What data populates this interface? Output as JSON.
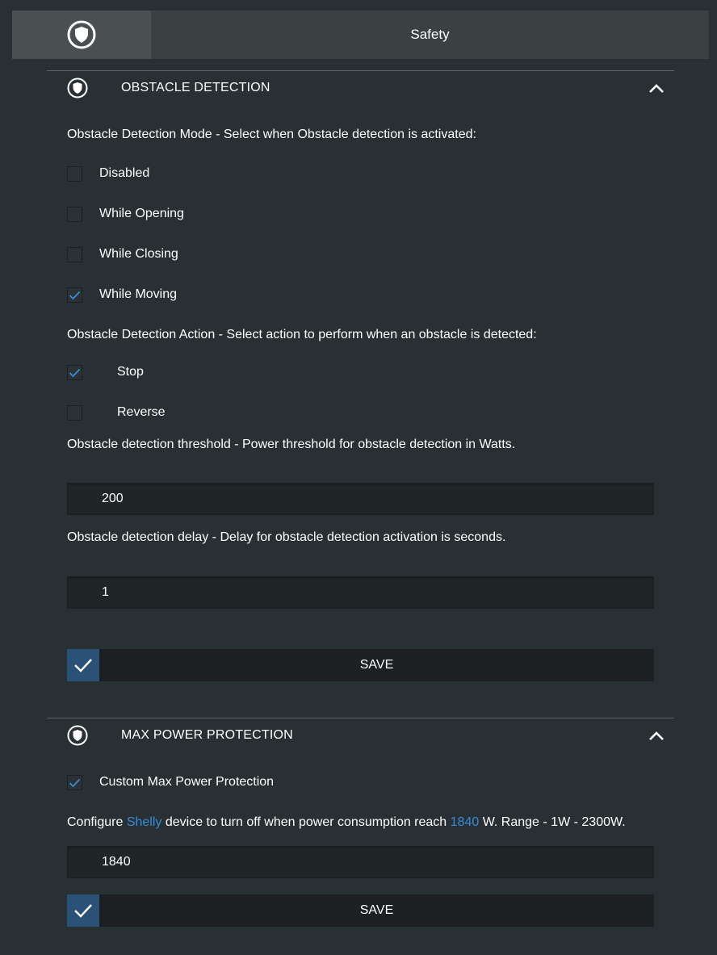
{
  "header": {
    "title": "Safety",
    "icon": "shield-icon"
  },
  "obstacle_section": {
    "title": "OBSTACLE DETECTION",
    "mode_prompt": "Obstacle Detection Mode - Select when Obstacle detection is activated:",
    "mode_options": [
      {
        "label": "Disabled",
        "checked": false
      },
      {
        "label": "While Opening",
        "checked": false
      },
      {
        "label": "While Closing",
        "checked": false
      },
      {
        "label": "While Moving",
        "checked": true
      }
    ],
    "action_prompt": "Obstacle Detection Action - Select action to perform when an obstacle is detected:",
    "action_options": [
      {
        "label": "Stop",
        "checked": true
      },
      {
        "label": "Reverse",
        "checked": false
      }
    ],
    "threshold_prompt": "Obstacle detection threshold - Power threshold for obstacle detection in Watts.",
    "threshold_value": "200",
    "delay_prompt": "Obstacle detection delay - Delay for obstacle detection activation is seconds.",
    "delay_value": "1",
    "save_label": "SAVE"
  },
  "max_power_section": {
    "title": "MAX POWER PROTECTION",
    "custom_label": "Custom Max Power Protection",
    "custom_checked": true,
    "description": {
      "prefix": "Configure ",
      "device": "Shelly",
      "middle": " device to turn off when power consumption reach ",
      "value": "1840",
      "suffix": " W. Range - 1W - 2300W."
    },
    "power_value": "1840",
    "save_label": "SAVE"
  },
  "colors": {
    "background": "#283033",
    "accent_blue": "#3a8bd9",
    "save_icon_bg": "#2a5277"
  }
}
